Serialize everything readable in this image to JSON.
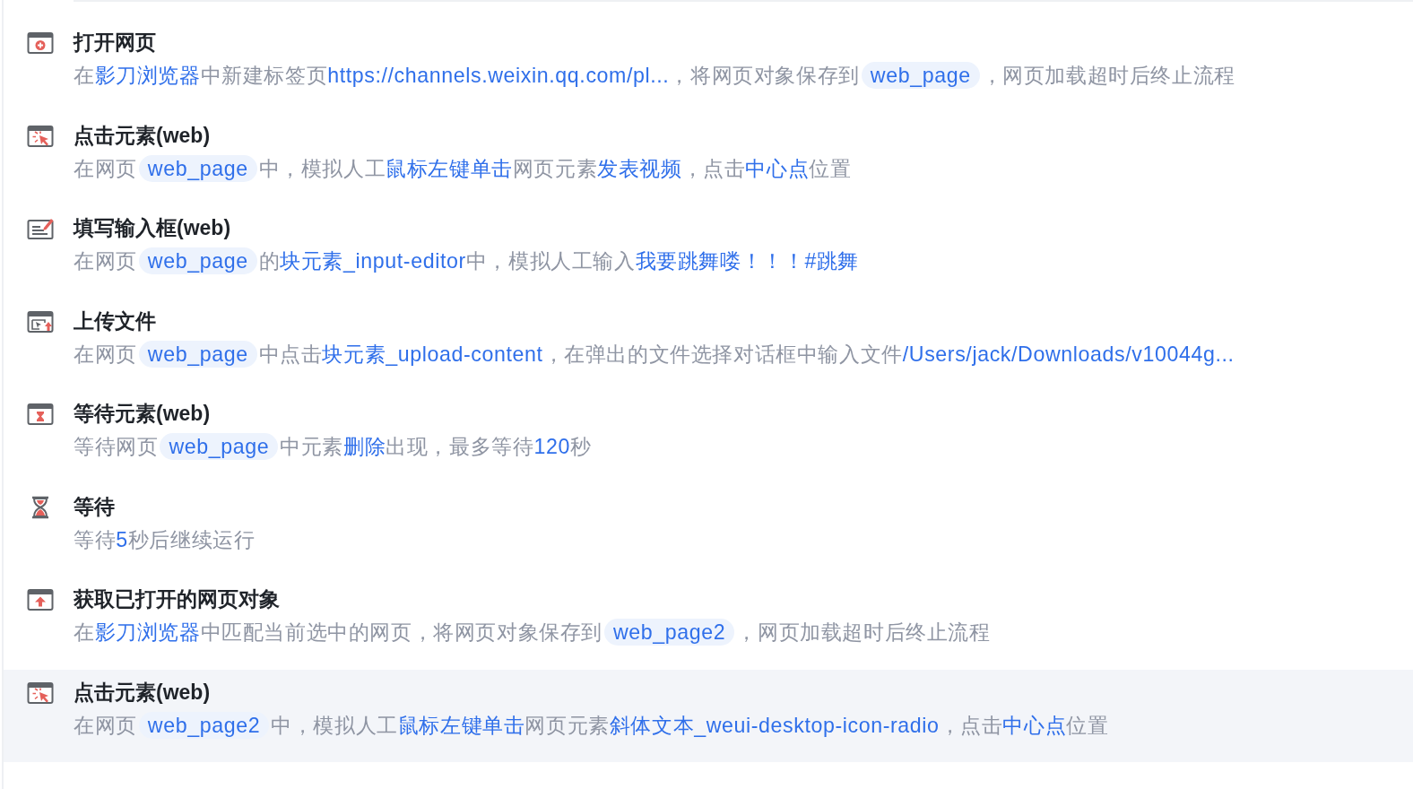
{
  "steps": [
    {
      "kind": "open-page",
      "title": "打开网页",
      "selected": false,
      "description": [
        {
          "kind": "plain",
          "text": "在"
        },
        {
          "kind": "value",
          "text": "影刀浏览器"
        },
        {
          "kind": "plain",
          "text": "中新建标签页"
        },
        {
          "kind": "value",
          "text": "https://channels.weixin.qq.com/pl..."
        },
        {
          "kind": "plain",
          "text": "，将网页对象保存到"
        },
        {
          "kind": "variable",
          "text": "web_page"
        },
        {
          "kind": "plain",
          "text": "，网页加载超时后终止流程"
        }
      ]
    },
    {
      "kind": "click",
      "title": "点击元素(web)",
      "selected": false,
      "description": [
        {
          "kind": "plain",
          "text": "在网页"
        },
        {
          "kind": "variable",
          "text": "web_page"
        },
        {
          "kind": "plain",
          "text": "中，模拟人工"
        },
        {
          "kind": "value",
          "text": "鼠标左键单击"
        },
        {
          "kind": "plain",
          "text": "网页元素"
        },
        {
          "kind": "value",
          "text": "发表视频"
        },
        {
          "kind": "plain",
          "text": "，点击"
        },
        {
          "kind": "value",
          "text": "中心点"
        },
        {
          "kind": "plain",
          "text": "位置"
        }
      ]
    },
    {
      "kind": "fill",
      "title": "填写输入框(web)",
      "selected": false,
      "description": [
        {
          "kind": "plain",
          "text": "在网页"
        },
        {
          "kind": "variable",
          "text": "web_page"
        },
        {
          "kind": "plain",
          "text": "的"
        },
        {
          "kind": "value",
          "text": "块元素_input-editor"
        },
        {
          "kind": "plain",
          "text": "中，模拟人工输入"
        },
        {
          "kind": "value",
          "text": "我要跳舞喽！！！#跳舞"
        }
      ]
    },
    {
      "kind": "upload",
      "title": "上传文件",
      "selected": false,
      "description": [
        {
          "kind": "plain",
          "text": "在网页"
        },
        {
          "kind": "variable",
          "text": "web_page"
        },
        {
          "kind": "plain",
          "text": "中点击"
        },
        {
          "kind": "value",
          "text": "块元素_upload-content"
        },
        {
          "kind": "plain",
          "text": "，在弹出的文件选择对话框中输入文件"
        },
        {
          "kind": "value",
          "text": "/Users/jack/Downloads/v10044g..."
        }
      ]
    },
    {
      "kind": "wait-element",
      "title": "等待元素(web)",
      "selected": false,
      "description": [
        {
          "kind": "plain",
          "text": "等待网页"
        },
        {
          "kind": "variable",
          "text": "web_page"
        },
        {
          "kind": "plain",
          "text": "中元素"
        },
        {
          "kind": "value",
          "text": "删除"
        },
        {
          "kind": "plain",
          "text": "出现，最多等待"
        },
        {
          "kind": "value",
          "text": "120"
        },
        {
          "kind": "plain",
          "text": "秒"
        }
      ]
    },
    {
      "kind": "wait",
      "title": "等待",
      "selected": false,
      "description": [
        {
          "kind": "plain",
          "text": "等待"
        },
        {
          "kind": "value",
          "text": "5"
        },
        {
          "kind": "plain",
          "text": "秒后继续运行"
        }
      ]
    },
    {
      "kind": "get-page",
      "title": "获取已打开的网页对象",
      "selected": false,
      "description": [
        {
          "kind": "plain",
          "text": "在"
        },
        {
          "kind": "value",
          "text": "影刀浏览器"
        },
        {
          "kind": "plain",
          "text": "中匹配当前选中的网页，将网页对象保存到"
        },
        {
          "kind": "variable",
          "text": "web_page2"
        },
        {
          "kind": "plain",
          "text": "，网页加载超时后终止流程"
        }
      ]
    },
    {
      "kind": "click",
      "title": "点击元素(web)",
      "selected": true,
      "description": [
        {
          "kind": "plain",
          "text": "在网页"
        },
        {
          "kind": "variable",
          "text": "web_page2"
        },
        {
          "kind": "plain",
          "text": "中，模拟人工"
        },
        {
          "kind": "value",
          "text": "鼠标左键单击"
        },
        {
          "kind": "plain",
          "text": "网页元素"
        },
        {
          "kind": "value",
          "text": "斜体文本_weui-desktop-icon-radio"
        },
        {
          "kind": "plain",
          "text": "，点击"
        },
        {
          "kind": "value",
          "text": "中心点"
        },
        {
          "kind": "plain",
          "text": "位置"
        }
      ]
    }
  ]
}
